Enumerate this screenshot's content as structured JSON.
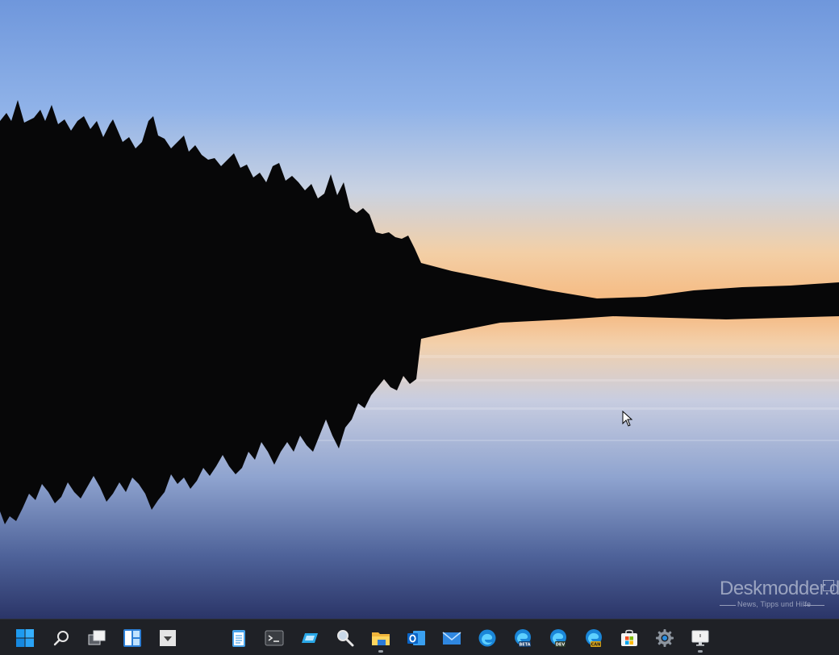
{
  "desktop": {
    "wallpaper": "lake-sunset-forest-reflection",
    "watermark": {
      "title": "Deskmodder.de",
      "subtitle": "News, Tipps und Hilfe"
    }
  },
  "taskbar": {
    "background": "#1f2126",
    "accent": "#0078d4",
    "items": [
      {
        "name": "start-button",
        "icon": "windows-logo-icon"
      },
      {
        "name": "search-button",
        "icon": "search-icon"
      },
      {
        "name": "task-view-button",
        "icon": "task-view-icon"
      },
      {
        "name": "widgets-button",
        "icon": "widgets-icon"
      },
      {
        "name": "chat-button",
        "icon": "chat-icon"
      },
      {
        "name": "notepad-button",
        "icon": "notepad-icon"
      },
      {
        "name": "terminal-button",
        "icon": "terminal-icon"
      },
      {
        "name": "remote-app-button",
        "icon": "remote-app-icon"
      },
      {
        "name": "magnifier-button",
        "icon": "magnifier-icon"
      },
      {
        "name": "file-explorer-button",
        "icon": "folder-icon"
      },
      {
        "name": "outlook-button",
        "icon": "outlook-icon"
      },
      {
        "name": "mail-button",
        "icon": "mail-icon"
      },
      {
        "name": "edge-button",
        "icon": "edge-icon"
      },
      {
        "name": "edge-beta-button",
        "icon": "edge-beta-icon",
        "badge": "BETA"
      },
      {
        "name": "edge-dev-button",
        "icon": "edge-dev-icon",
        "badge": "DEV"
      },
      {
        "name": "edge-canary-button",
        "icon": "edge-canary-icon",
        "badge": "CAN"
      },
      {
        "name": "store-button",
        "icon": "store-icon"
      },
      {
        "name": "settings-button",
        "icon": "gear-icon"
      },
      {
        "name": "display-button",
        "icon": "display-icon"
      }
    ]
  }
}
